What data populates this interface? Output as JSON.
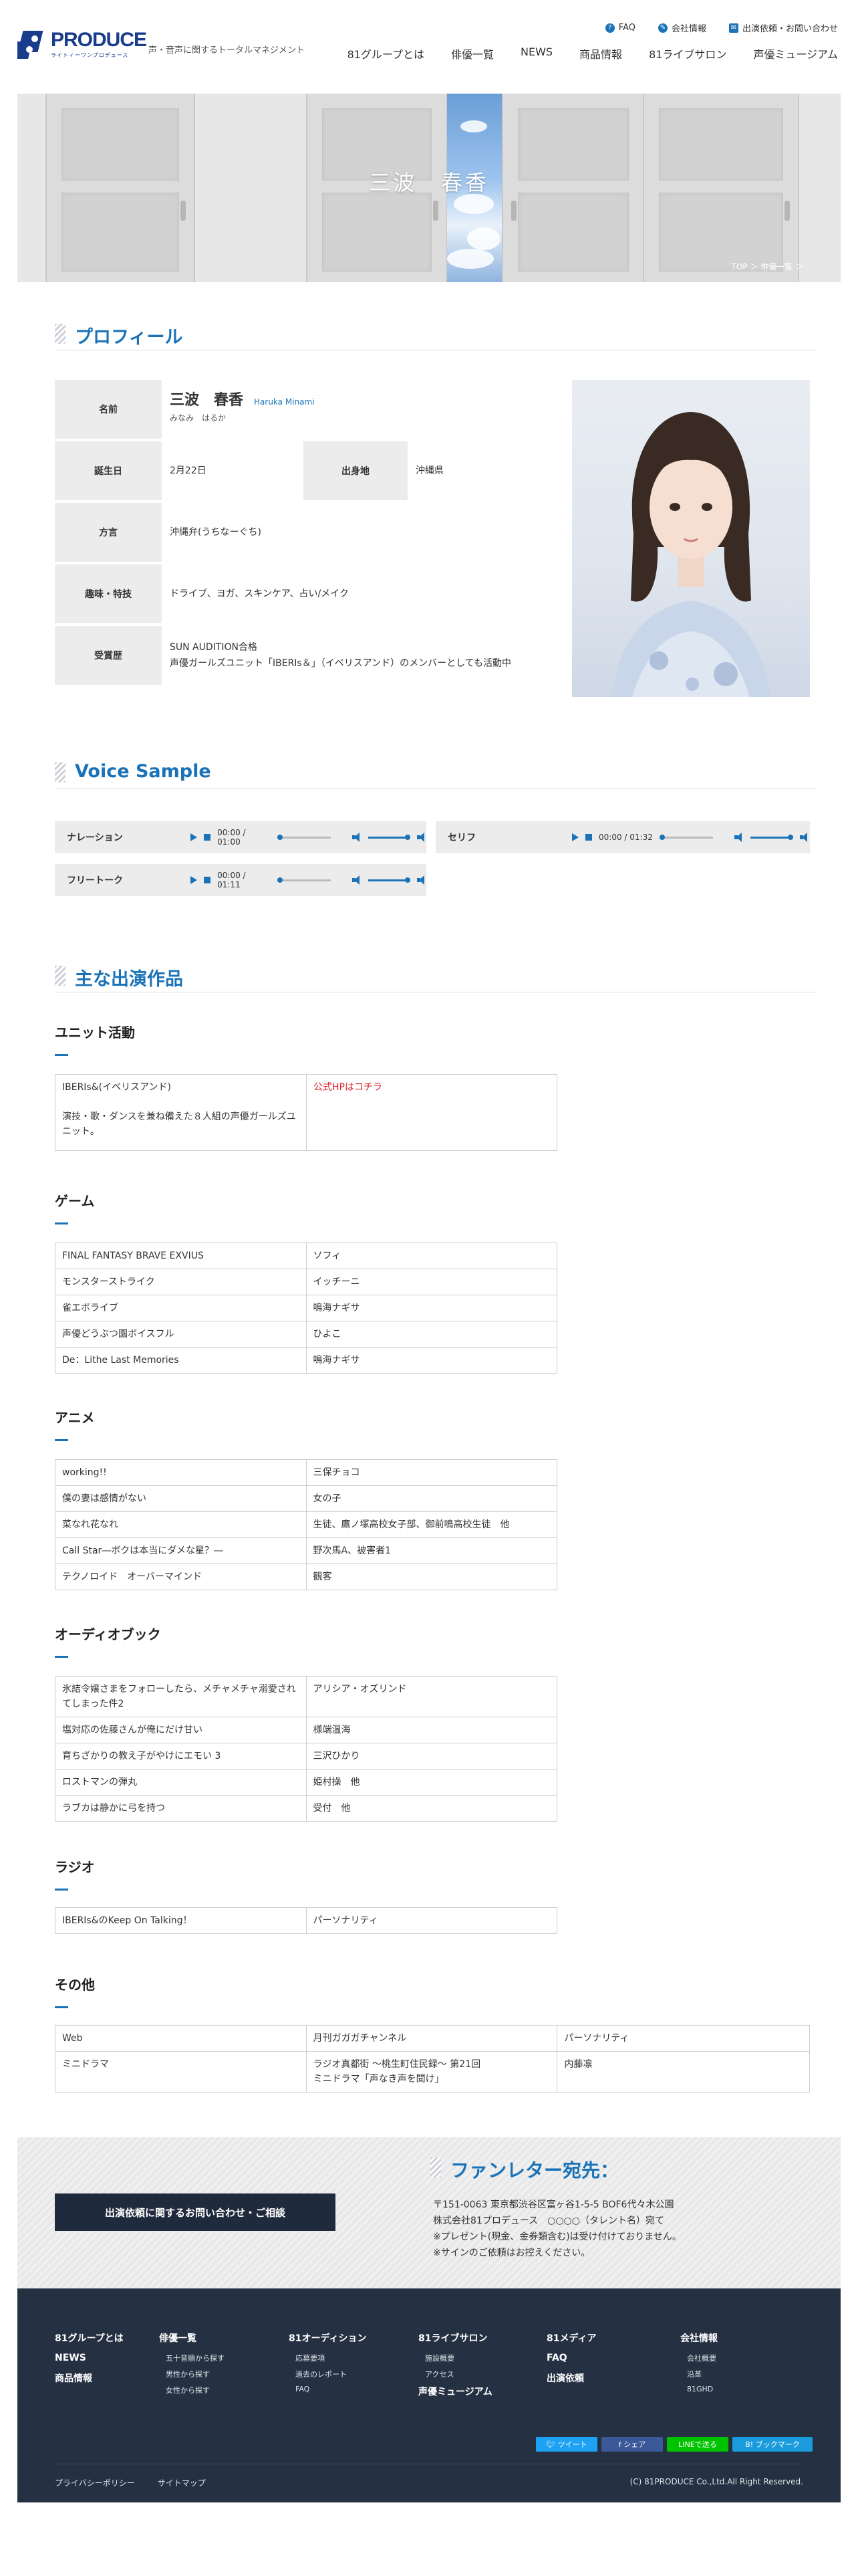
{
  "header": {
    "logo_text": "PRODUCE",
    "logo_sub": "ライトィーワンプロデュース",
    "tagline": "声・音声に関するトータルマネジメント",
    "util": [
      "FAQ",
      "会社情報",
      "出演依頼・お問い合わせ"
    ],
    "nav": [
      "81グループとは",
      "俳優一覧",
      "NEWS",
      "商品情報",
      "81ライブサロン",
      "声優ミュージアム"
    ]
  },
  "hero": {
    "title": "三波　春香",
    "breadcrumb": "TOP ＞ 俳優一覧 ＞"
  },
  "profile": {
    "heading": "プロフィール",
    "name_label": "名前",
    "name": "三波　春香",
    "name_roman": "Haruka Minami",
    "name_kana": "みなみ　はるか",
    "birthday_label": "誕生日",
    "birthday": "2月22日",
    "birthplace_label": "出身地",
    "birthplace": "沖縄県",
    "dialect_label": "方言",
    "dialect": "沖縄弁(うちなーぐち)",
    "hobby_label": "趣味・特技",
    "hobby": "ドライブ、ヨガ、スキンケア、占い/メイク",
    "award_label": "受賞歴",
    "award_line1": "SUN AUDITION合格",
    "award_line2": "声優ガールズユニット「IBERIs＆」（イベリスアンド）のメンバーとしても活動中"
  },
  "voice": {
    "heading": "Voice Sample",
    "samples": [
      {
        "label": "ナレーション",
        "time": "00:00 / 01:00"
      },
      {
        "label": "セリフ",
        "time": "00:00 / 01:32"
      },
      {
        "label": "フリートーク",
        "time": "00:00 / 01:11"
      }
    ]
  },
  "works": {
    "heading": "主な出演作品",
    "unit": {
      "title": "ユニット活動",
      "name": "IBERIs&(イベリスアンド)",
      "desc": "演技・歌・ダンスを兼ね備えた８人組の声優ガールズユニット。",
      "link": "公式HPはコチラ"
    },
    "game": {
      "title": "ゲーム",
      "rows": [
        [
          "FINAL FANTASY BRAVE EXVIUS",
          "ソフィ"
        ],
        [
          "モンスターストライク",
          "イッチーニ"
        ],
        [
          "雀エボライブ",
          "鳴海ナギサ"
        ],
        [
          "声優どうぶつ園ボイスフル",
          "ひよこ"
        ],
        [
          "De：Lithe Last Memories",
          "鳴海ナギサ"
        ]
      ]
    },
    "anime": {
      "title": "アニメ",
      "rows": [
        [
          "working!!",
          "三保チョコ"
        ],
        [
          "僕の妻は感情がない",
          "女の子"
        ],
        [
          "菜なれ花なれ",
          "生徒、鷹ノ塚高校女子部、御前鳴高校生徒　他"
        ],
        [
          "Call Star―ボクは本当にダメな星？―",
          "野次馬A、被害者1"
        ],
        [
          "テクノロイド　オーバーマインド",
          "観客"
        ]
      ]
    },
    "audio": {
      "title": "オーディオブック",
      "rows": [
        [
          "氷結令嬢さまをフォローしたら、メチャメチャ溺愛されてしまった件2",
          "アリシア・オズリンド"
        ],
        [
          "塩対応の佐藤さんが俺にだけ甘い",
          "様端温海"
        ],
        [
          "育ちざかりの教え子がやけにエモい 3",
          "三沢ひかり"
        ],
        [
          "ロストマンの弾丸",
          "姫村操　他"
        ],
        [
          "ラブカは静かに弓を持つ",
          "受付　他"
        ]
      ]
    },
    "radio": {
      "title": "ラジオ",
      "rows": [
        [
          "IBERIs&のKeep On Talking！",
          "パーソナリティ"
        ]
      ]
    },
    "other": {
      "title": "その他",
      "rows": [
        [
          "Web",
          "月刊ガガガチャンネル",
          "パーソナリティ"
        ],
        [
          "ミニドラマ",
          "ラジオ真都街 〜桃生町住民録〜 第21回\nミニドラマ「声なき声を聞け」",
          "内藤凛"
        ]
      ]
    }
  },
  "contact": {
    "button": "出演依頼に関するお問い合わせ・ご相談",
    "fan_title": "ファンレター宛先：",
    "fan_lines": [
      "〒151-0063 東京都渋谷区富ヶ谷1-5-5 BOF6代々木公園",
      "株式会社81プロデュース　○○○○（タレント名）宛て",
      "※プレゼント(現金、金券類含む)は受け付けておりません。",
      "※サインのご依頼はお控えください。"
    ]
  },
  "footer": {
    "cols": [
      {
        "head": "81グループとは",
        "extra": [
          "NEWS",
          "商品情報"
        ],
        "subs": []
      },
      {
        "head": "俳優一覧",
        "extra": [],
        "subs": [
          "五十音順から探す",
          "男性から探す",
          "女性から探す"
        ]
      },
      {
        "head": "81オーディション",
        "extra": [],
        "subs": [
          "応募要項",
          "過去のレポート",
          "FAQ"
        ]
      },
      {
        "head": "81ライブサロン",
        "extra": [
          "声優ミュージアム"
        ],
        "subs": [
          "施設概要",
          "アクセス"
        ]
      },
      {
        "head": "81メディア",
        "extra": [
          "FAQ",
          "出演依頼"
        ],
        "subs": []
      },
      {
        "head": "会社情報",
        "extra": [],
        "subs": [
          "会社概要",
          "沿革",
          "81GHD"
        ]
      }
    ],
    "share": [
      "ツイート",
      "シェア",
      "LINEで送る",
      "ブックマーク"
    ],
    "links": [
      "プライバシーポリシー",
      "サイトマップ"
    ],
    "copyright": "(C) 81PRODUCE Co.,Ltd.All Right Reserved."
  },
  "colors": {
    "accent": "#1a73b8",
    "dark": "#253142",
    "red": "#d8232a"
  }
}
